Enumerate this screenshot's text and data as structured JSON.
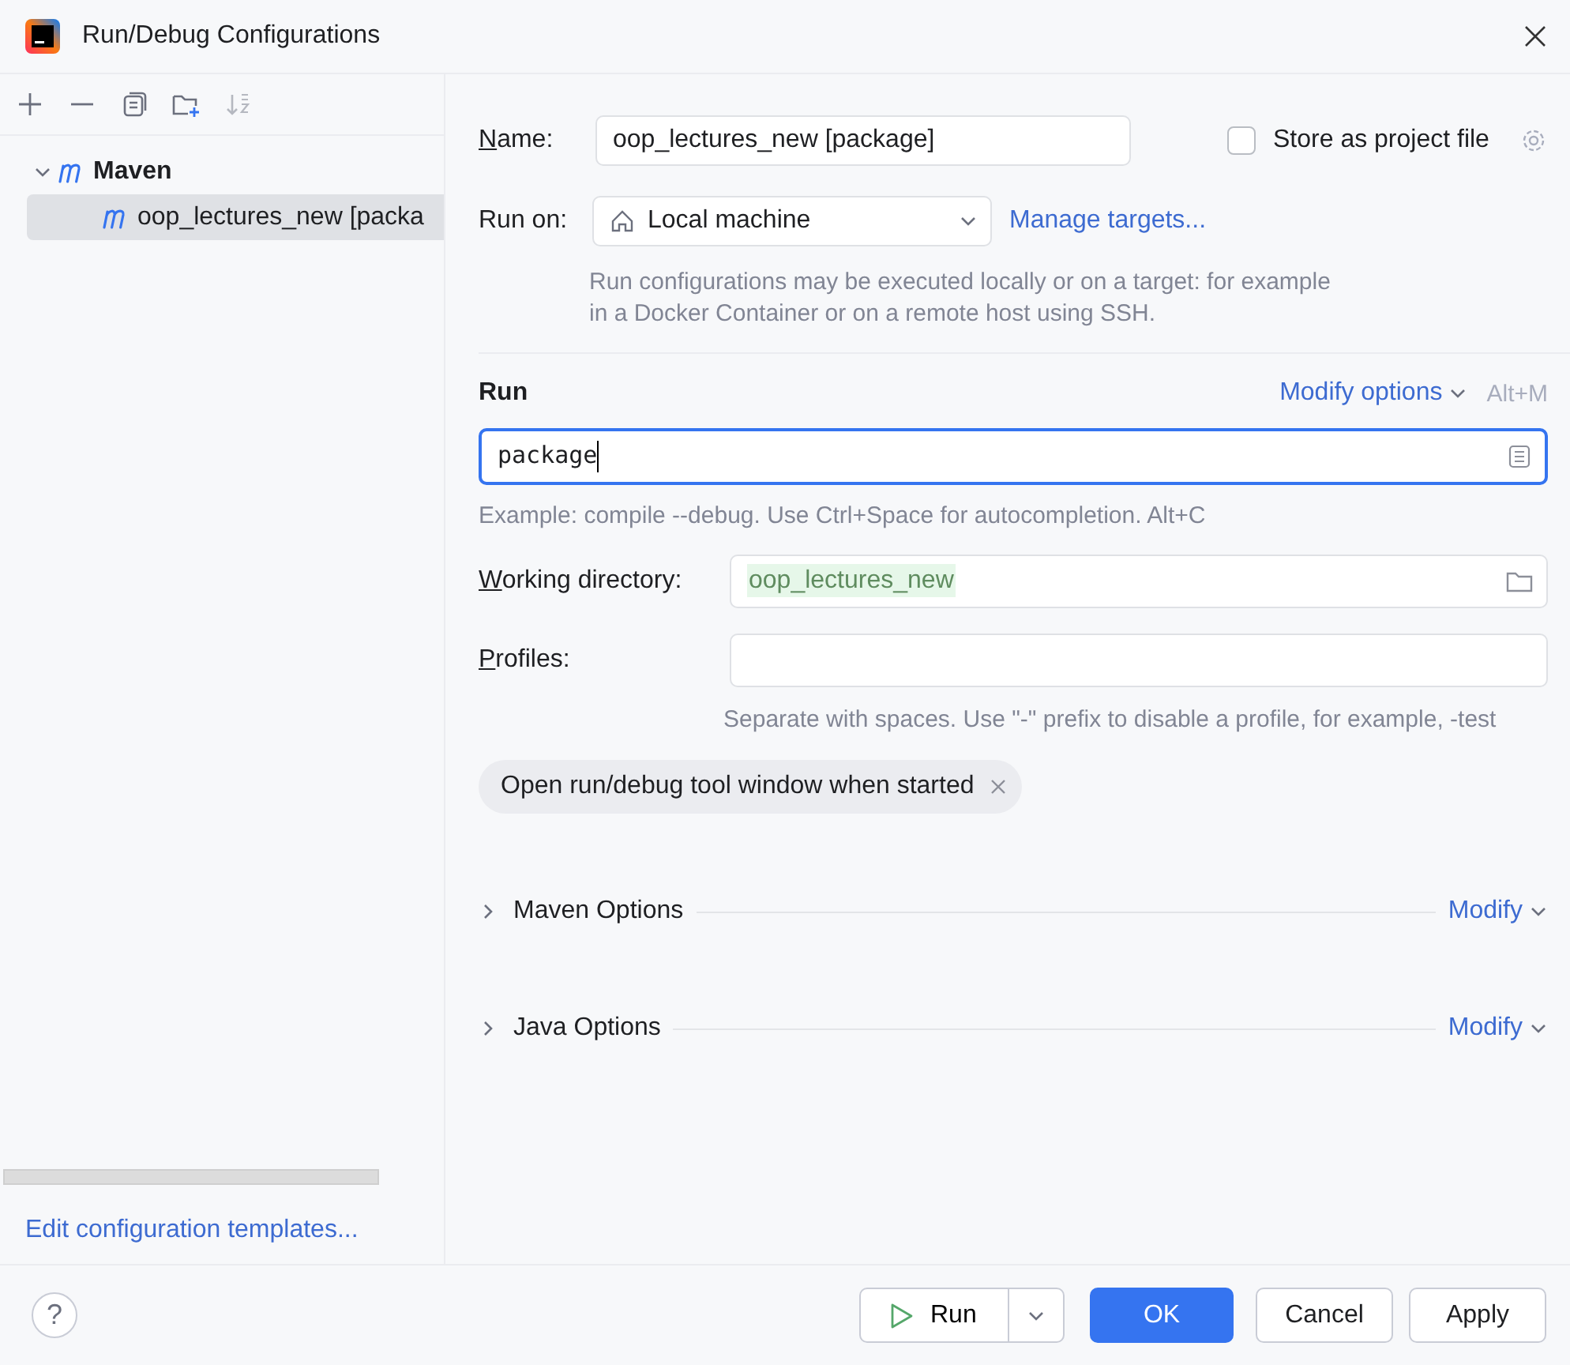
{
  "window": {
    "title": "Run/Debug Configurations"
  },
  "toolbar": [
    {
      "kind": "add",
      "disabled": false
    },
    {
      "kind": "remove",
      "disabled": false
    },
    {
      "kind": "copy",
      "disabled": false
    },
    {
      "kind": "new-folder",
      "disabled": false
    },
    {
      "kind": "sort",
      "disabled": true
    }
  ],
  "tree": [
    {
      "label": "Maven",
      "expanded": true,
      "selected": false,
      "children": [
        {
          "label": "oop_lectures_new [packa",
          "selected": true
        }
      ]
    }
  ],
  "edit_templates_link": "Edit configuration templates...",
  "form": {
    "name_label": "Name:",
    "name_value": "oop_lectures_new [package]",
    "store_checkbox": {
      "label": "Store as project file",
      "checked": false
    },
    "run_on_label": "Run on:",
    "run_on_value": "Local machine",
    "manage_targets_link": "Manage targets...",
    "run_on_hint": "Run configurations may be executed locally or on a target: for example in a Docker Container or on a remote host using SSH.",
    "run_title": "Run",
    "modify_options": "Modify options",
    "modify_shortcut": "Alt+M",
    "command_value": "package",
    "command_hint": "Example: compile --debug. Use Ctrl+Space for autocompletion. Alt+C",
    "working_dir_label": "Working directory:",
    "working_dir_value": "oop_lectures_new",
    "profiles_label": "Profiles:",
    "profiles_hint": "Separate with spaces. Use \"-\" prefix to disable a profile, for example, -test",
    "tags": [
      "Open run/debug tool window when started"
    ],
    "sections": [
      {
        "title": "Maven Options",
        "expanded": false,
        "modify": "Modify"
      },
      {
        "title": "Java Options",
        "expanded": false,
        "modify": "Modify"
      }
    ]
  },
  "footer": {
    "help": "?",
    "run_button": "Run",
    "buttons": [
      {
        "label": "OK",
        "kind": "primary"
      },
      {
        "label": "Cancel",
        "kind": "default"
      },
      {
        "label": "Apply",
        "kind": "default"
      }
    ]
  }
}
